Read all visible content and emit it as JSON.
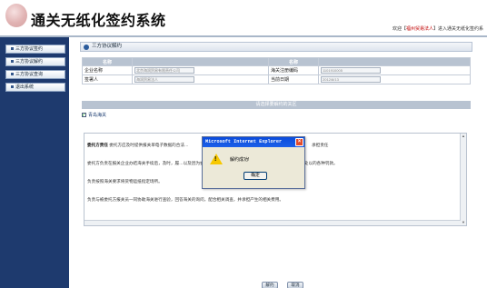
{
  "header": {
    "title": "通关无纸化签约系统",
    "welcome_prefix": "欢迎【",
    "welcome_user": "福州贸易法人",
    "welcome_suffix": "】进入通关无纸化签约系"
  },
  "sidebar": {
    "items": [
      {
        "label": "三方协议签约"
      },
      {
        "label": "三方协议解约"
      },
      {
        "label": "三方协议查询"
      },
      {
        "label": "退出系统"
      }
    ]
  },
  "section": {
    "title": "三方协议解约"
  },
  "form": {
    "col_name": "名称",
    "col_name2": "名称",
    "row1_label": "企业名称",
    "row1_value": "北京海润贸易有限责任公司",
    "row1_label2": "海关注册编码",
    "row1_value2": "1101910005",
    "row2_label": "签署人",
    "row2_value": "海润贸易法人",
    "row2_label2": "当前日期",
    "row2_value2": "2012/8/13"
  },
  "customs": {
    "bar_title": "请选择要解约的关区",
    "checkbox_label": "青岛海关"
  },
  "agreement": {
    "para1_bold": "委托方责任",
    "para1": "委托方应及时提供报关单电子数据的合法…",
    "para1_tail": "承担责任",
    "para2": "委托方负责在报关企业办结海关手续后，及时，履…以及因为委托方责任产生的滞报金、滞纳金和海关等执法单位依法处以的各种罚款。",
    "para3": "负责按照海关要求将货物运抵指定场所。",
    "para4": "负责与被委托方报关员一同协助海关进行查验，回答海关的询问，配合相关调查，并承担产生的相关费用。"
  },
  "dialog": {
    "title": "Microsoft Internet Explorer",
    "message": "解约成功!",
    "ok": "确定"
  },
  "buttons": {
    "submit": "解约",
    "cancel": "取消"
  }
}
